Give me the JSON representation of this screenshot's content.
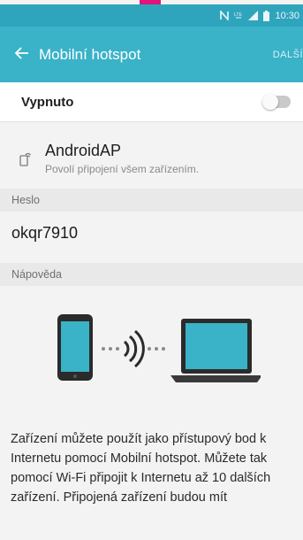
{
  "status_bar": {
    "time": "10:30",
    "icons": [
      "nfc-icon",
      "lte-icon",
      "signal-icon",
      "battery-icon"
    ]
  },
  "app_bar": {
    "back_icon": "arrow-left-icon",
    "title": "Mobilní hotspot",
    "action_label": "DALŠÍ"
  },
  "toggle": {
    "label": "Vypnuto",
    "state": "off"
  },
  "network": {
    "icon": "phone-share-icon",
    "name": "AndroidAP",
    "subtitle": "Povolí připojení všem zařízením."
  },
  "password_section": {
    "header": "Heslo",
    "value": "okqr7910"
  },
  "help_section": {
    "header": "Nápověda",
    "illustration_icons": [
      "phone-icon",
      "wifi-waves-icon",
      "laptop-icon"
    ],
    "text": "Zařízení můžete použít jako přístupový bod k Internetu pomocí Mobilní hotspot. Můžete tak pomocí Wi-Fi připojit k Internetu až 10 dalších zařízení. Připojená zařízení budou mít"
  },
  "colors": {
    "accent_pink": "#e0147a",
    "status_bar": "#2fa5bd",
    "app_bar": "#3ab2c8"
  }
}
